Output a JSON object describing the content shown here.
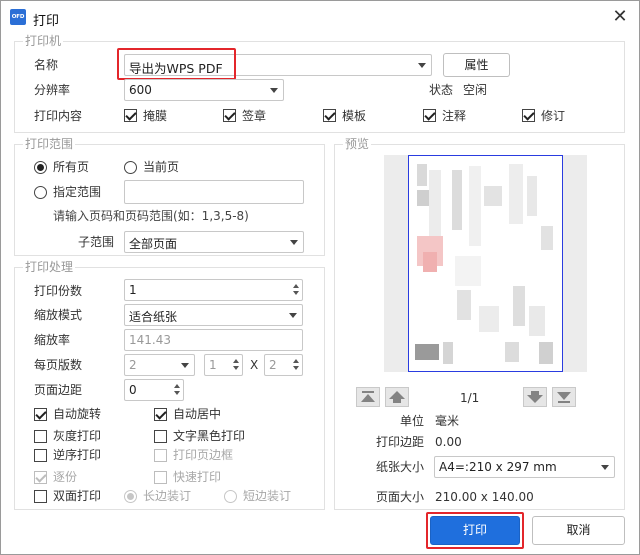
{
  "window": {
    "title": "打印",
    "app_icon_text": "OFD"
  },
  "printer": {
    "group_label": "打印机",
    "name_label": "名称",
    "name_value": "导出为WPS PDF",
    "properties_button": "属性",
    "resolution_label": "分辨率",
    "resolution_value": "600",
    "status_label": "状态",
    "status_value": "空闲",
    "content_label": "打印内容",
    "content_options": [
      {
        "label": "掩膜",
        "checked": true
      },
      {
        "label": "签章",
        "checked": true
      },
      {
        "label": "模板",
        "checked": true
      },
      {
        "label": "注释",
        "checked": true
      },
      {
        "label": "修订",
        "checked": true
      }
    ]
  },
  "range": {
    "group_label": "打印范围",
    "all_pages": "所有页",
    "current_page": "当前页",
    "specified_range": "指定范围",
    "range_input_value": "",
    "hint": "请输入页码和页码范围(如：1,3,5-8)",
    "subrange_label": "子范围",
    "subrange_value": "全部页面"
  },
  "processing": {
    "group_label": "打印处理",
    "copies_label": "打印份数",
    "copies_value": "1",
    "scale_mode_label": "缩放模式",
    "scale_mode_value": "适合纸张",
    "scale_rate_label": "缩放率",
    "scale_rate_value": "141.43",
    "pages_per_sheet_label": "每页版数",
    "pages_per_sheet_value": "2",
    "grid_cols_value": "1",
    "grid_x": "X",
    "grid_rows_value": "2",
    "margin_label": "页面边距",
    "margin_value": "0",
    "options": {
      "auto_rotate": "自动旋转",
      "auto_center": "自动居中",
      "grayscale": "灰度打印",
      "text_black": "文字黑色打印",
      "reverse": "逆序打印",
      "print_border": "打印页边框",
      "collate": "逐份",
      "quick_print": "快速打印",
      "duplex": "双面打印",
      "long_edge": "长边装订",
      "short_edge": "短边装订"
    }
  },
  "preview": {
    "group_label": "预览",
    "page_indicator": "1/1",
    "unit_label": "单位",
    "unit_value": "毫米",
    "margin_label": "打印边距",
    "margin_value": "0.00",
    "paper_size_label": "纸张大小",
    "paper_size_value": "A4=:210 x 297 mm",
    "page_size_label": "页面大小",
    "page_size_value": "210.00 x 140.00"
  },
  "footer": {
    "print_button": "打印",
    "cancel_button": "取消"
  },
  "colors": {
    "highlight": "#e3262b",
    "accent": "#2a3ce0",
    "primary_button": "#1f6fdd"
  }
}
